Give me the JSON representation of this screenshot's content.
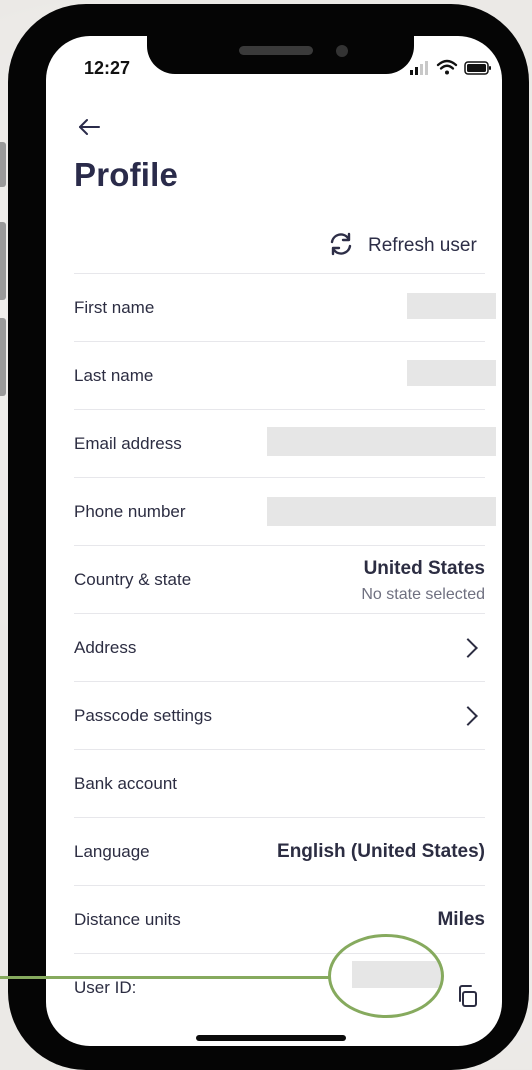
{
  "status_bar": {
    "time": "12:27"
  },
  "header": {
    "title": "Profile",
    "back_icon": "arrow-left-icon"
  },
  "refresh": {
    "label": "Refresh user",
    "icon": "refresh-icon"
  },
  "rows": {
    "first_name": {
      "label": "First name"
    },
    "last_name": {
      "label": "Last name"
    },
    "email": {
      "label": "Email address"
    },
    "phone": {
      "label": "Phone number"
    },
    "country": {
      "label": "Country & state",
      "country": "United States",
      "state": "No state selected"
    },
    "address": {
      "label": "Address"
    },
    "passcode": {
      "label": "Passcode settings"
    },
    "bank": {
      "label": "Bank account"
    },
    "language": {
      "label": "Language",
      "value": "English (United States)"
    },
    "distance": {
      "label": "Distance units",
      "value": "Miles"
    },
    "user_id": {
      "label": "User ID:"
    }
  },
  "colors": {
    "annotation": "#86aa5e",
    "text": "#2c2d42",
    "title": "#2a2b4a"
  }
}
